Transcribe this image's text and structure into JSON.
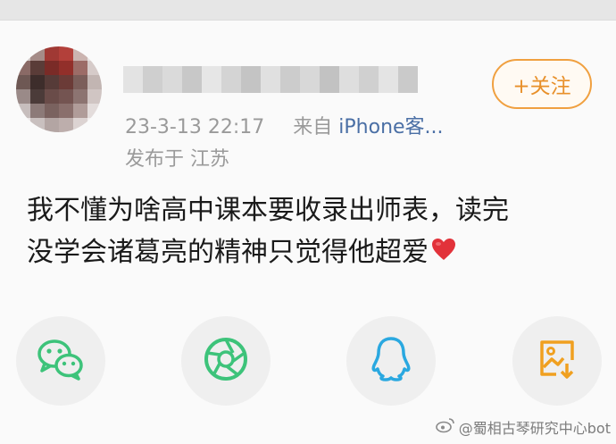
{
  "post": {
    "timestamp": "23-3-13 22:17",
    "source_prefix": "来自",
    "source_name": "iPhone客...",
    "location": "发布于 江苏",
    "text_line1": "我不懂为啥高中课本要收录出师表，读完",
    "text_line2": "没学会诸葛亮的精神只觉得他超爱"
  },
  "follow_button": {
    "label": "+关注"
  },
  "share_bar": {
    "items": [
      {
        "icon": "wechat-icon",
        "color": "#3dc37a"
      },
      {
        "icon": "moments-icon",
        "color": "#3dc37a"
      },
      {
        "icon": "qq-icon",
        "color": "#2aa8e0"
      },
      {
        "icon": "save-image-icon",
        "color": "#f0a020"
      }
    ]
  },
  "watermark": {
    "text": "@蜀相古琴研究中心bot"
  },
  "colors": {
    "accent": "#e8902a",
    "meta_text": "#9a9a9a",
    "heart": "#e2323a"
  }
}
